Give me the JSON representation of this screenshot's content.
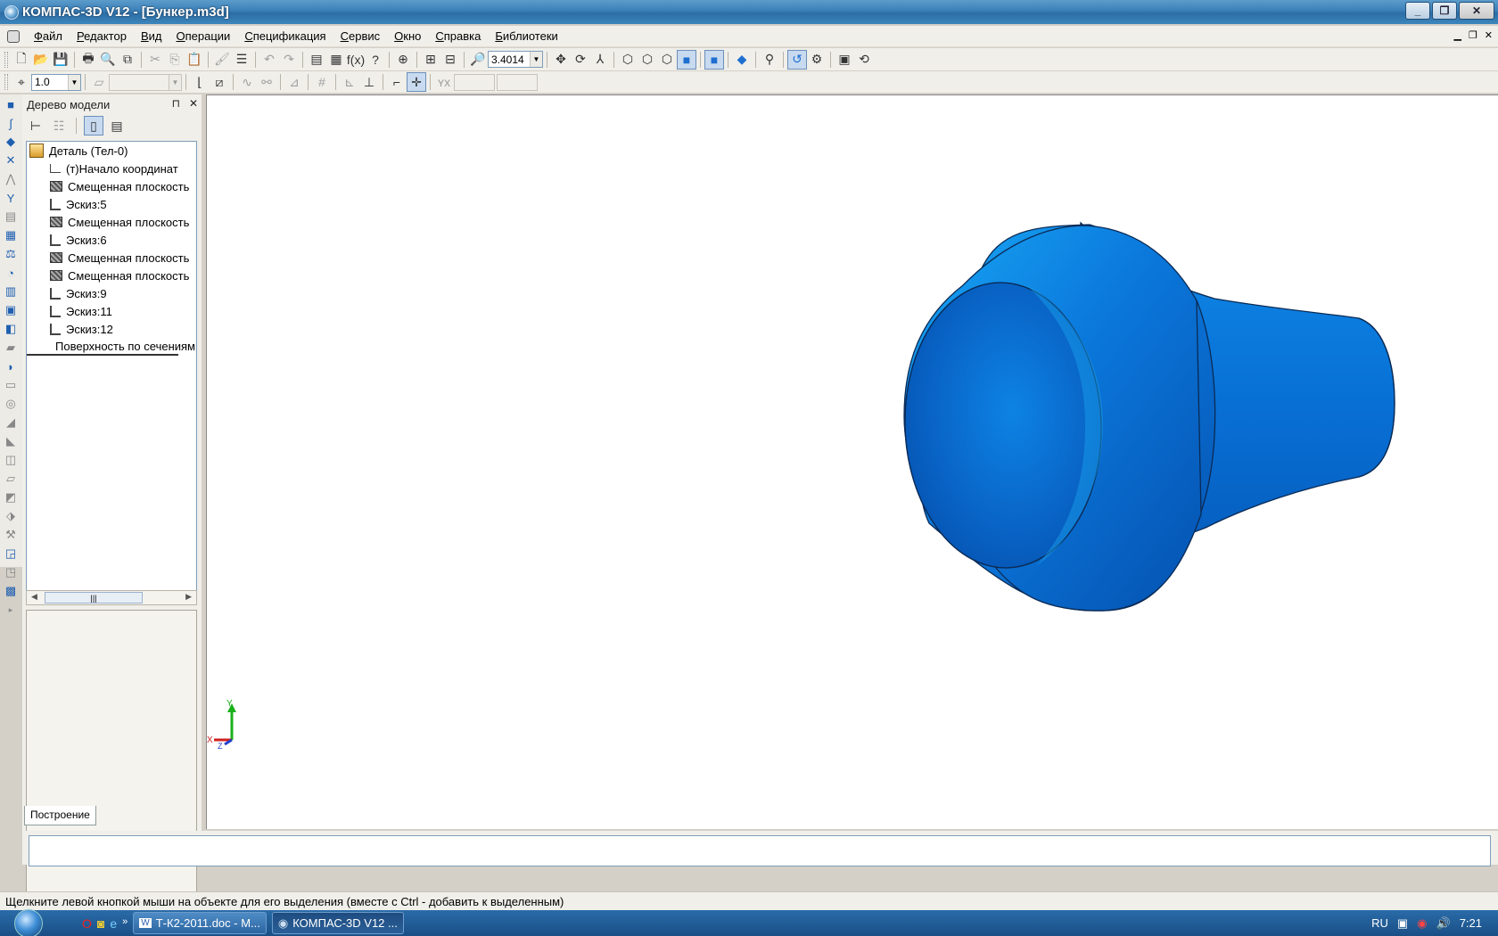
{
  "window": {
    "title": "КОМПАС-3D V12 - [Бункер.m3d]",
    "buttons": [
      "_",
      "❐",
      "✕"
    ]
  },
  "menu": {
    "items": [
      "Файл",
      "Редактор",
      "Вид",
      "Операции",
      "Спецификация",
      "Сервис",
      "Окно",
      "Справка",
      "Библиотеки"
    ]
  },
  "toolbar": {
    "zoom_value": "3.4014",
    "step_value": "1.0"
  },
  "model_tree": {
    "header": "Дерево модели",
    "root": "Деталь (Тел-0)",
    "items": [
      {
        "label": "(т)Начало координат",
        "icon": "origin-icon"
      },
      {
        "label": "Смещенная плоскость",
        "icon": "plane-icon"
      },
      {
        "label": "Эскиз:5",
        "icon": "sketch-icon"
      },
      {
        "label": "Смещенная плоскость",
        "icon": "plane-icon"
      },
      {
        "label": "Эскиз:6",
        "icon": "sketch-icon"
      },
      {
        "label": "Смещенная плоскость",
        "icon": "plane-icon"
      },
      {
        "label": "Смещенная плоскость",
        "icon": "plane-icon"
      },
      {
        "label": "Эскиз:9",
        "icon": "sketch-icon"
      },
      {
        "label": "Эскиз:11",
        "icon": "sketch-icon"
      },
      {
        "label": "Эскиз:12",
        "icon": "sketch-icon"
      },
      {
        "label": "Поверхность по сечениям",
        "icon": "loft-surface-icon"
      }
    ],
    "tab": "Построение"
  },
  "axes": {
    "x": "X",
    "y": "Y",
    "z": "Z"
  },
  "status": {
    "message": "Щелкните левой кнопкой мыши на объекте для его выделения (вместе с Ctrl - добавить к выделенным)"
  },
  "taskbar": {
    "tasks": [
      {
        "label": "Т-К2-2011.doc - M..."
      },
      {
        "label": "КОМПАС-3D V12 ..."
      }
    ],
    "language": "RU",
    "time": "7:21"
  },
  "colors": {
    "model_main": "#0a6fd6",
    "model_light": "#18a8f5",
    "model_dark": "#0552b0"
  }
}
